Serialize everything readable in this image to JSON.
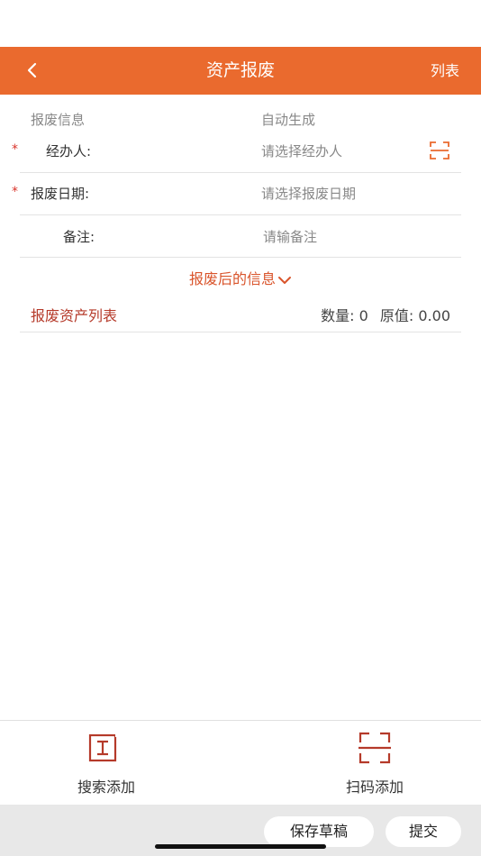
{
  "header": {
    "title": "资产报废",
    "right_label": "列表"
  },
  "form": {
    "info": {
      "label": "报废信息",
      "value": "自动生成"
    },
    "handler": {
      "required": "*",
      "label": "经办人:",
      "placeholder": "请选择经办人"
    },
    "date": {
      "required": "*",
      "label": "报废日期:",
      "placeholder": "请选择报废日期"
    },
    "remark": {
      "label": "备注:",
      "placeholder": "请输备注"
    }
  },
  "expand": {
    "label": "报废后的信息"
  },
  "asset_list": {
    "title": "报废资产列表",
    "quantity_label": "数量:",
    "quantity": "0",
    "original_label": "原值:",
    "original_value": "0.00"
  },
  "actions": {
    "search_add": "搜索添加",
    "scan_add": "扫码添加"
  },
  "footer": {
    "save_draft": "保存草稿",
    "submit": "提交"
  },
  "colors": {
    "accent": "#EA6A2E",
    "required": "#D9342B",
    "list_title": "#B53A2A"
  }
}
